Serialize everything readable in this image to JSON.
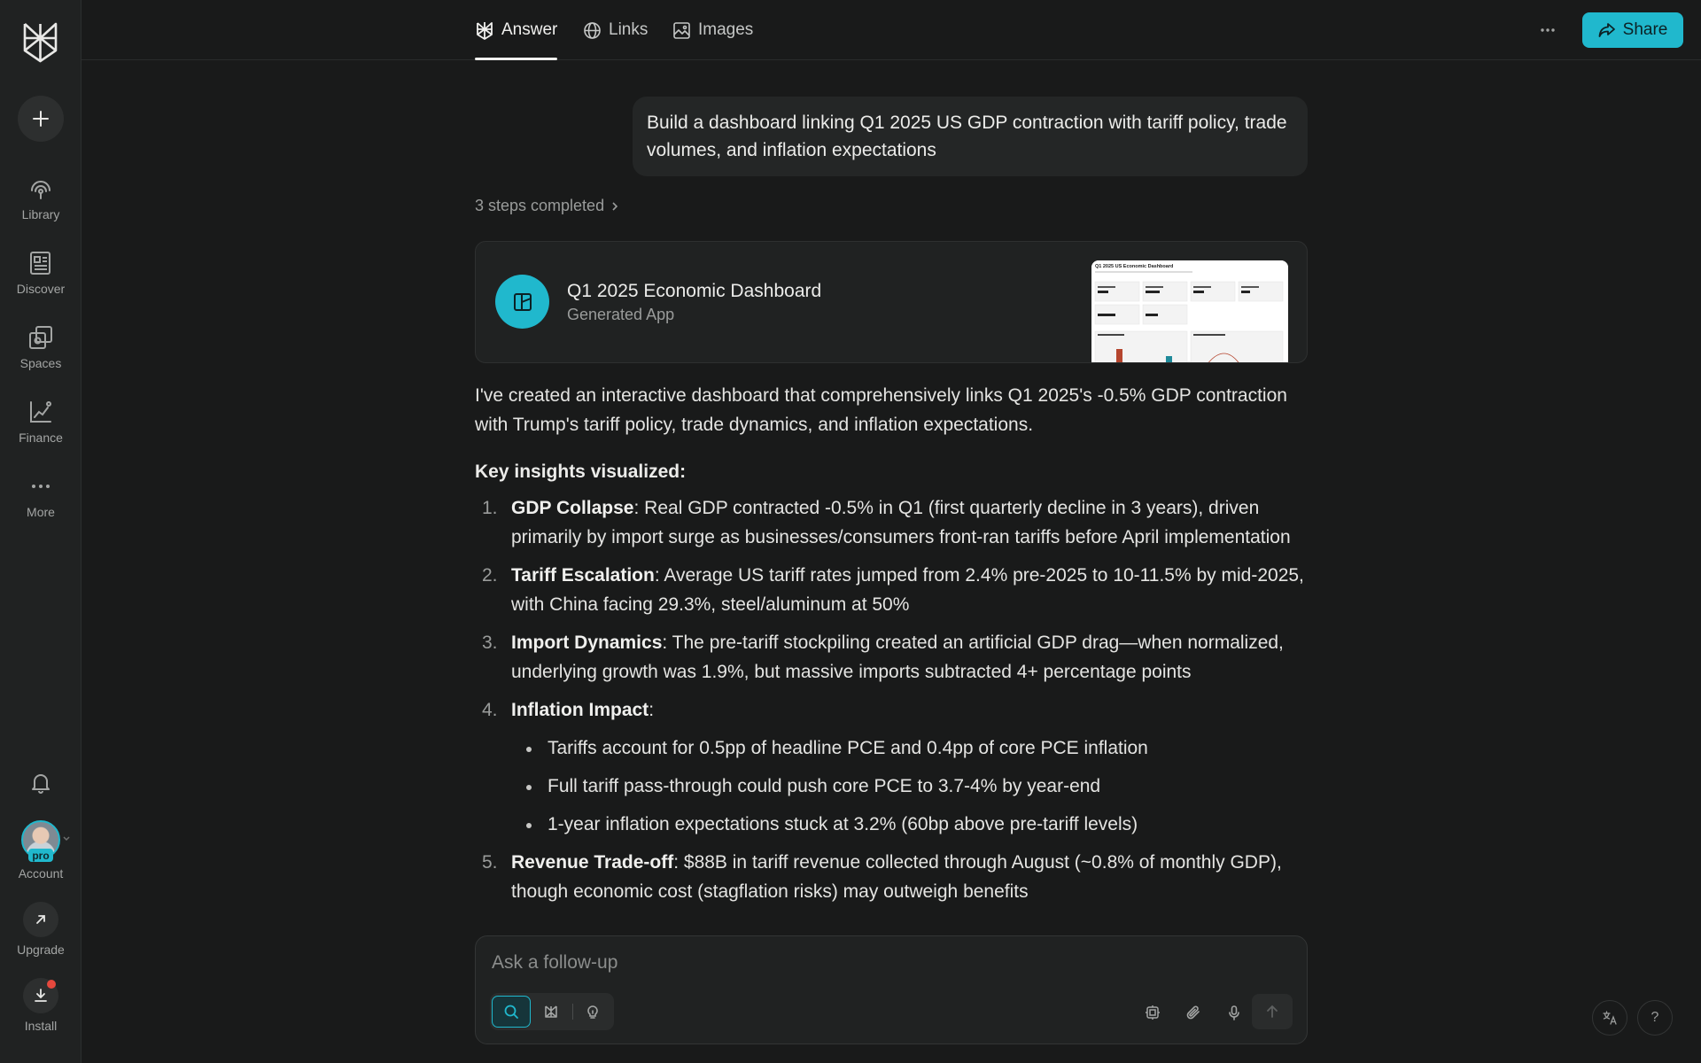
{
  "sidebar": {
    "logo": "perplexity-logo",
    "new_thread_icon": "plus-icon",
    "items": [
      {
        "label": "Library",
        "icon": "library-icon"
      },
      {
        "label": "Discover",
        "icon": "newspaper-icon"
      },
      {
        "label": "Spaces",
        "icon": "spaces-icon"
      },
      {
        "label": "Finance",
        "icon": "chart-icon"
      },
      {
        "label": "More",
        "icon": "more-dots-icon"
      }
    ],
    "notifications_icon": "bell-icon",
    "account": {
      "label": "Account",
      "badge": "pro"
    },
    "upgrade": {
      "label": "Upgrade"
    },
    "install": {
      "label": "Install"
    }
  },
  "topbar": {
    "tabs": [
      {
        "label": "Answer",
        "active": true,
        "icon": "answer-icon"
      },
      {
        "label": "Links",
        "active": false,
        "icon": "globe-icon"
      },
      {
        "label": "Images",
        "active": false,
        "icon": "image-icon"
      }
    ],
    "share_label": "Share"
  },
  "thread": {
    "query": "Build a dashboard linking Q1 2025 US GDP contraction with tariff policy, trade volumes, and inflation expectations",
    "steps_label": "3 steps completed",
    "app_card": {
      "title": "Q1 2025 Economic Dashboard",
      "subtitle": "Generated App",
      "thumbnail_title": "Q1 2025 US Economic Dashboard"
    },
    "intro": "I've created an interactive dashboard that comprehensively links Q1 2025's -0.5% GDP contraction with Trump's tariff policy, trade dynamics, and inflation expectations.",
    "insights_heading": "Key insights visualized:",
    "insights": [
      {
        "num": "1.",
        "title": "GDP Collapse",
        "text": ": Real GDP contracted -0.5% in Q1 (first quarterly decline in 3 years), driven primarily by import surge as businesses/consumers front-ran tariffs before April implementation"
      },
      {
        "num": "2.",
        "title": "Tariff Escalation",
        "text": ": Average US tariff rates jumped from 2.4% pre-2025 to 10-11.5% by mid-2025, with China facing 29.3%, steel/aluminum at 50%"
      },
      {
        "num": "3.",
        "title": "Import Dynamics",
        "text": ": The pre-tariff stockpiling created an artificial GDP drag—when normalized, underlying growth was 1.9%, but massive imports subtracted 4+ percentage points"
      },
      {
        "num": "4.",
        "title": "Inflation Impact",
        "text": ":"
      },
      {
        "num": "5.",
        "title": "Revenue Trade-off",
        "text": ": $88B in tariff revenue collected through August (~0.8% of monthly GDP), though economic cost (stagflation risks) may outweigh benefits"
      }
    ],
    "inflation_bullets": [
      "Tariffs account for 0.5pp of headline PCE and 0.4pp of core PCE inflation",
      "Full tariff pass-through could push core PCE to 3.7-4% by year-end",
      "1-year inflation expectations stuck at 3.2% (60bp above pre-tariff levels)"
    ]
  },
  "composer": {
    "placeholder": "Ask a follow-up",
    "value": "",
    "modes": [
      "search-icon",
      "research-icon",
      "labs-bulb-icon"
    ],
    "tools": [
      "model-chip-icon",
      "paperclip-icon",
      "microphone-icon"
    ],
    "send_icon": "arrow-up-icon"
  },
  "corner": {
    "translate_icon": "translate-icon",
    "help_label": "?"
  },
  "colors": {
    "accent": "#20b8cd",
    "background": "#191a1a",
    "sidebar": "#202222",
    "notification": "#e5483d"
  }
}
